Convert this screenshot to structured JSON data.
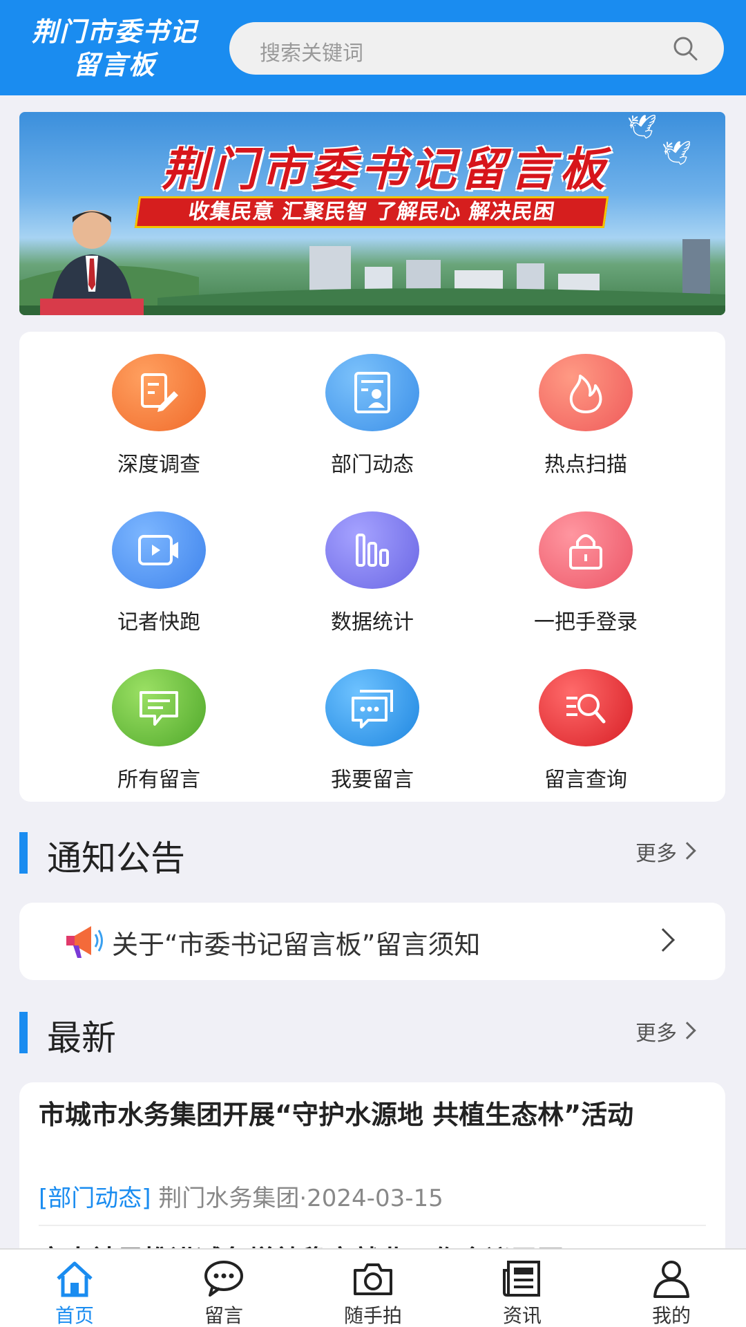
{
  "header": {
    "logo_line1": "荆门市委书记",
    "logo_line2": "留言板",
    "search_placeholder": "搜索关键词"
  },
  "banner": {
    "title": "荆门市委书记留言板",
    "slogan": "收集民意 汇聚民智 了解民心 解决民困"
  },
  "grid": [
    {
      "label": "深度调查",
      "icon": "survey-icon",
      "color": "#f47a3a"
    },
    {
      "label": "部门动态",
      "icon": "department-news-icon",
      "color": "#4aa3f0"
    },
    {
      "label": "热点扫描",
      "icon": "fire-icon",
      "color": "#f36a6a"
    },
    {
      "label": "记者快跑",
      "icon": "video-icon",
      "color": "#4f95f0"
    },
    {
      "label": "数据统计",
      "icon": "bar-chart-icon",
      "color": "#7a78ea"
    },
    {
      "label": "一把手登录",
      "icon": "lock-icon",
      "color": "#f26a78"
    },
    {
      "label": "所有留言",
      "icon": "message-icon",
      "color": "#6dbb3a"
    },
    {
      "label": "我要留言",
      "icon": "chat-icon",
      "color": "#2e9ae8"
    },
    {
      "label": "留言查询",
      "icon": "search-list-icon",
      "color": "#e8323a"
    }
  ],
  "notices": {
    "title": "通知公告",
    "more": "更多",
    "item": "关于“市委书记留言板”留言须知"
  },
  "latest": {
    "title": "最新",
    "more": "更多",
    "item_title": "市城市水务集团开展“守护水源地 共植生态林”活动",
    "item_category": "[部门动态]",
    "item_meta": "荆门水务集团·2024-03-15",
    "next_title": "市人社局推进减负增效稳定就业工作会议召开"
  },
  "tabbar": [
    {
      "label": "首页",
      "icon": "home-icon",
      "active": true
    },
    {
      "label": "留言",
      "icon": "message-bubble-icon",
      "active": false
    },
    {
      "label": "随手拍",
      "icon": "camera-icon",
      "active": false
    },
    {
      "label": "资讯",
      "icon": "newspaper-icon",
      "active": false
    },
    {
      "label": "我的",
      "icon": "user-icon",
      "active": false
    }
  ],
  "colors": {
    "primary": "#1a8cf0",
    "background": "#f0f0f6"
  }
}
